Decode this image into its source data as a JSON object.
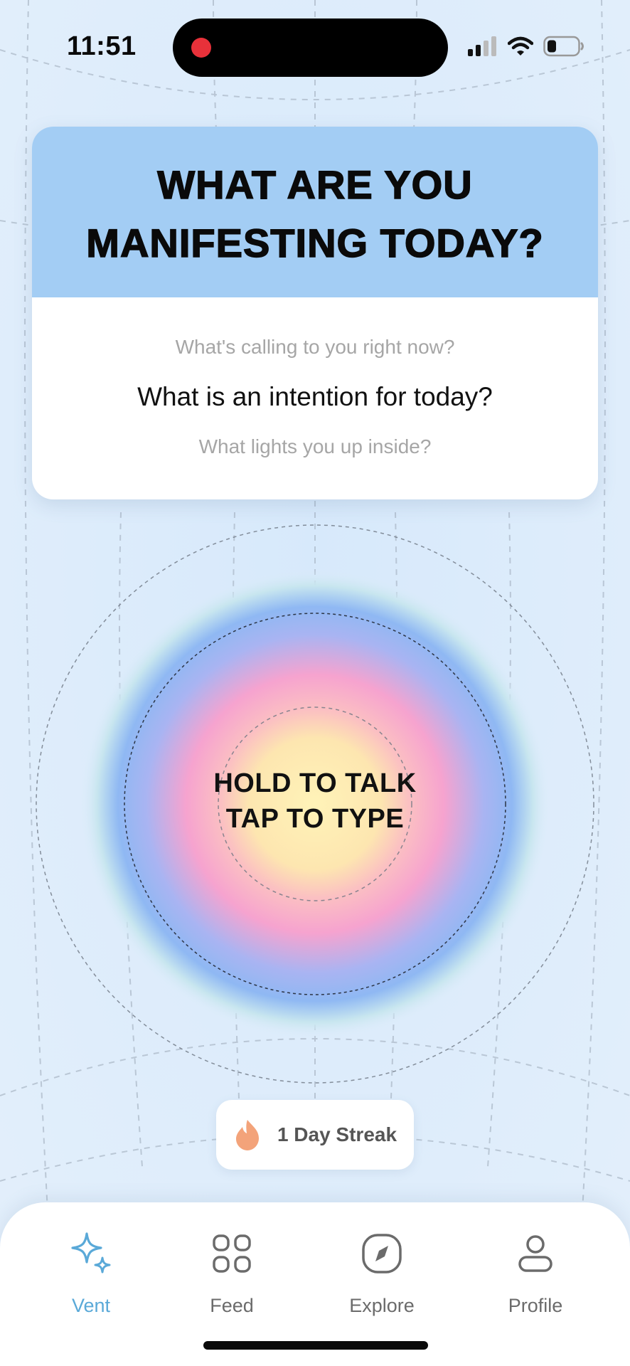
{
  "status_bar": {
    "time": "11:51",
    "battery_level": 0.3
  },
  "prompt_card": {
    "title_line1": "WHAT ARE YOU",
    "title_line2": "MANIFESTING TODAY?",
    "prompt_above": "What's calling to you right now?",
    "prompt_current": "What is an intention for today?",
    "prompt_below": "What lights you up inside?"
  },
  "orb": {
    "line1": "HOLD TO TALK",
    "line2": "TAP TO TYPE"
  },
  "streak": {
    "label": "1 Day Streak",
    "icon": "flame-icon"
  },
  "tabs": [
    {
      "label": "Vent",
      "icon": "sparkle-icon",
      "active": true
    },
    {
      "label": "Feed",
      "icon": "grid-icon",
      "active": false
    },
    {
      "label": "Explore",
      "icon": "compass-icon",
      "active": false
    },
    {
      "label": "Profile",
      "icon": "person-icon",
      "active": false
    }
  ],
  "colors": {
    "accent": "#5aa9d8",
    "header_bg": "#a3cdf4",
    "background": "#dcebfa",
    "flame": "#f3a37a"
  }
}
